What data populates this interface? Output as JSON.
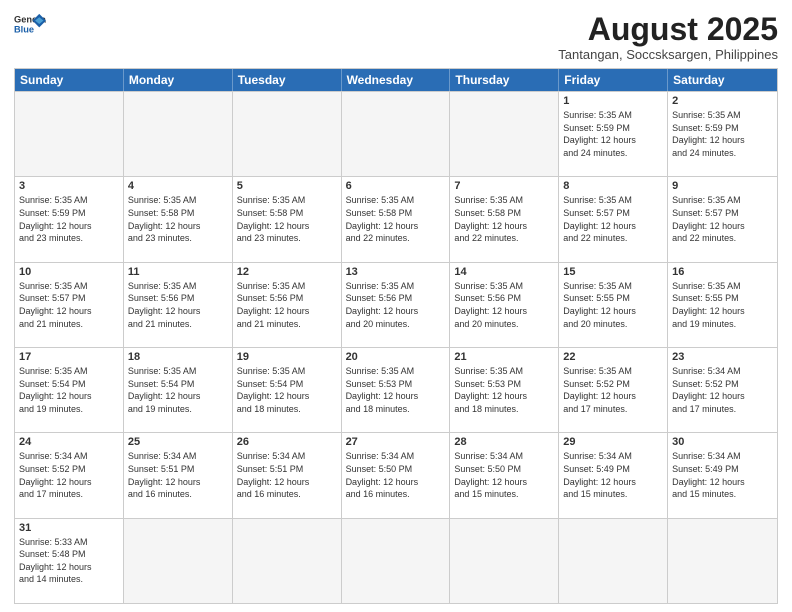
{
  "header": {
    "logo_general": "General",
    "logo_blue": "Blue",
    "month_year": "August 2025",
    "location": "Tantangan, Soccsksargen, Philippines"
  },
  "weekdays": [
    "Sunday",
    "Monday",
    "Tuesday",
    "Wednesday",
    "Thursday",
    "Friday",
    "Saturday"
  ],
  "rows": [
    [
      {
        "day": "",
        "info": "",
        "empty": true
      },
      {
        "day": "",
        "info": "",
        "empty": true
      },
      {
        "day": "",
        "info": "",
        "empty": true
      },
      {
        "day": "",
        "info": "",
        "empty": true
      },
      {
        "day": "",
        "info": "",
        "empty": true
      },
      {
        "day": "1",
        "info": "Sunrise: 5:35 AM\nSunset: 5:59 PM\nDaylight: 12 hours\nand 24 minutes.",
        "empty": false
      },
      {
        "day": "2",
        "info": "Sunrise: 5:35 AM\nSunset: 5:59 PM\nDaylight: 12 hours\nand 24 minutes.",
        "empty": false
      }
    ],
    [
      {
        "day": "3",
        "info": "Sunrise: 5:35 AM\nSunset: 5:59 PM\nDaylight: 12 hours\nand 23 minutes.",
        "empty": false
      },
      {
        "day": "4",
        "info": "Sunrise: 5:35 AM\nSunset: 5:58 PM\nDaylight: 12 hours\nand 23 minutes.",
        "empty": false
      },
      {
        "day": "5",
        "info": "Sunrise: 5:35 AM\nSunset: 5:58 PM\nDaylight: 12 hours\nand 23 minutes.",
        "empty": false
      },
      {
        "day": "6",
        "info": "Sunrise: 5:35 AM\nSunset: 5:58 PM\nDaylight: 12 hours\nand 22 minutes.",
        "empty": false
      },
      {
        "day": "7",
        "info": "Sunrise: 5:35 AM\nSunset: 5:58 PM\nDaylight: 12 hours\nand 22 minutes.",
        "empty": false
      },
      {
        "day": "8",
        "info": "Sunrise: 5:35 AM\nSunset: 5:57 PM\nDaylight: 12 hours\nand 22 minutes.",
        "empty": false
      },
      {
        "day": "9",
        "info": "Sunrise: 5:35 AM\nSunset: 5:57 PM\nDaylight: 12 hours\nand 22 minutes.",
        "empty": false
      }
    ],
    [
      {
        "day": "10",
        "info": "Sunrise: 5:35 AM\nSunset: 5:57 PM\nDaylight: 12 hours\nand 21 minutes.",
        "empty": false
      },
      {
        "day": "11",
        "info": "Sunrise: 5:35 AM\nSunset: 5:56 PM\nDaylight: 12 hours\nand 21 minutes.",
        "empty": false
      },
      {
        "day": "12",
        "info": "Sunrise: 5:35 AM\nSunset: 5:56 PM\nDaylight: 12 hours\nand 21 minutes.",
        "empty": false
      },
      {
        "day": "13",
        "info": "Sunrise: 5:35 AM\nSunset: 5:56 PM\nDaylight: 12 hours\nand 20 minutes.",
        "empty": false
      },
      {
        "day": "14",
        "info": "Sunrise: 5:35 AM\nSunset: 5:56 PM\nDaylight: 12 hours\nand 20 minutes.",
        "empty": false
      },
      {
        "day": "15",
        "info": "Sunrise: 5:35 AM\nSunset: 5:55 PM\nDaylight: 12 hours\nand 20 minutes.",
        "empty": false
      },
      {
        "day": "16",
        "info": "Sunrise: 5:35 AM\nSunset: 5:55 PM\nDaylight: 12 hours\nand 19 minutes.",
        "empty": false
      }
    ],
    [
      {
        "day": "17",
        "info": "Sunrise: 5:35 AM\nSunset: 5:54 PM\nDaylight: 12 hours\nand 19 minutes.",
        "empty": false
      },
      {
        "day": "18",
        "info": "Sunrise: 5:35 AM\nSunset: 5:54 PM\nDaylight: 12 hours\nand 19 minutes.",
        "empty": false
      },
      {
        "day": "19",
        "info": "Sunrise: 5:35 AM\nSunset: 5:54 PM\nDaylight: 12 hours\nand 18 minutes.",
        "empty": false
      },
      {
        "day": "20",
        "info": "Sunrise: 5:35 AM\nSunset: 5:53 PM\nDaylight: 12 hours\nand 18 minutes.",
        "empty": false
      },
      {
        "day": "21",
        "info": "Sunrise: 5:35 AM\nSunset: 5:53 PM\nDaylight: 12 hours\nand 18 minutes.",
        "empty": false
      },
      {
        "day": "22",
        "info": "Sunrise: 5:35 AM\nSunset: 5:52 PM\nDaylight: 12 hours\nand 17 minutes.",
        "empty": false
      },
      {
        "day": "23",
        "info": "Sunrise: 5:34 AM\nSunset: 5:52 PM\nDaylight: 12 hours\nand 17 minutes.",
        "empty": false
      }
    ],
    [
      {
        "day": "24",
        "info": "Sunrise: 5:34 AM\nSunset: 5:52 PM\nDaylight: 12 hours\nand 17 minutes.",
        "empty": false
      },
      {
        "day": "25",
        "info": "Sunrise: 5:34 AM\nSunset: 5:51 PM\nDaylight: 12 hours\nand 16 minutes.",
        "empty": false
      },
      {
        "day": "26",
        "info": "Sunrise: 5:34 AM\nSunset: 5:51 PM\nDaylight: 12 hours\nand 16 minutes.",
        "empty": false
      },
      {
        "day": "27",
        "info": "Sunrise: 5:34 AM\nSunset: 5:50 PM\nDaylight: 12 hours\nand 16 minutes.",
        "empty": false
      },
      {
        "day": "28",
        "info": "Sunrise: 5:34 AM\nSunset: 5:50 PM\nDaylight: 12 hours\nand 15 minutes.",
        "empty": false
      },
      {
        "day": "29",
        "info": "Sunrise: 5:34 AM\nSunset: 5:49 PM\nDaylight: 12 hours\nand 15 minutes.",
        "empty": false
      },
      {
        "day": "30",
        "info": "Sunrise: 5:34 AM\nSunset: 5:49 PM\nDaylight: 12 hours\nand 15 minutes.",
        "empty": false
      }
    ],
    [
      {
        "day": "31",
        "info": "Sunrise: 5:33 AM\nSunset: 5:48 PM\nDaylight: 12 hours\nand 14 minutes.",
        "empty": false
      },
      {
        "day": "",
        "info": "",
        "empty": true
      },
      {
        "day": "",
        "info": "",
        "empty": true
      },
      {
        "day": "",
        "info": "",
        "empty": true
      },
      {
        "day": "",
        "info": "",
        "empty": true
      },
      {
        "day": "",
        "info": "",
        "empty": true
      },
      {
        "day": "",
        "info": "",
        "empty": true
      }
    ]
  ]
}
